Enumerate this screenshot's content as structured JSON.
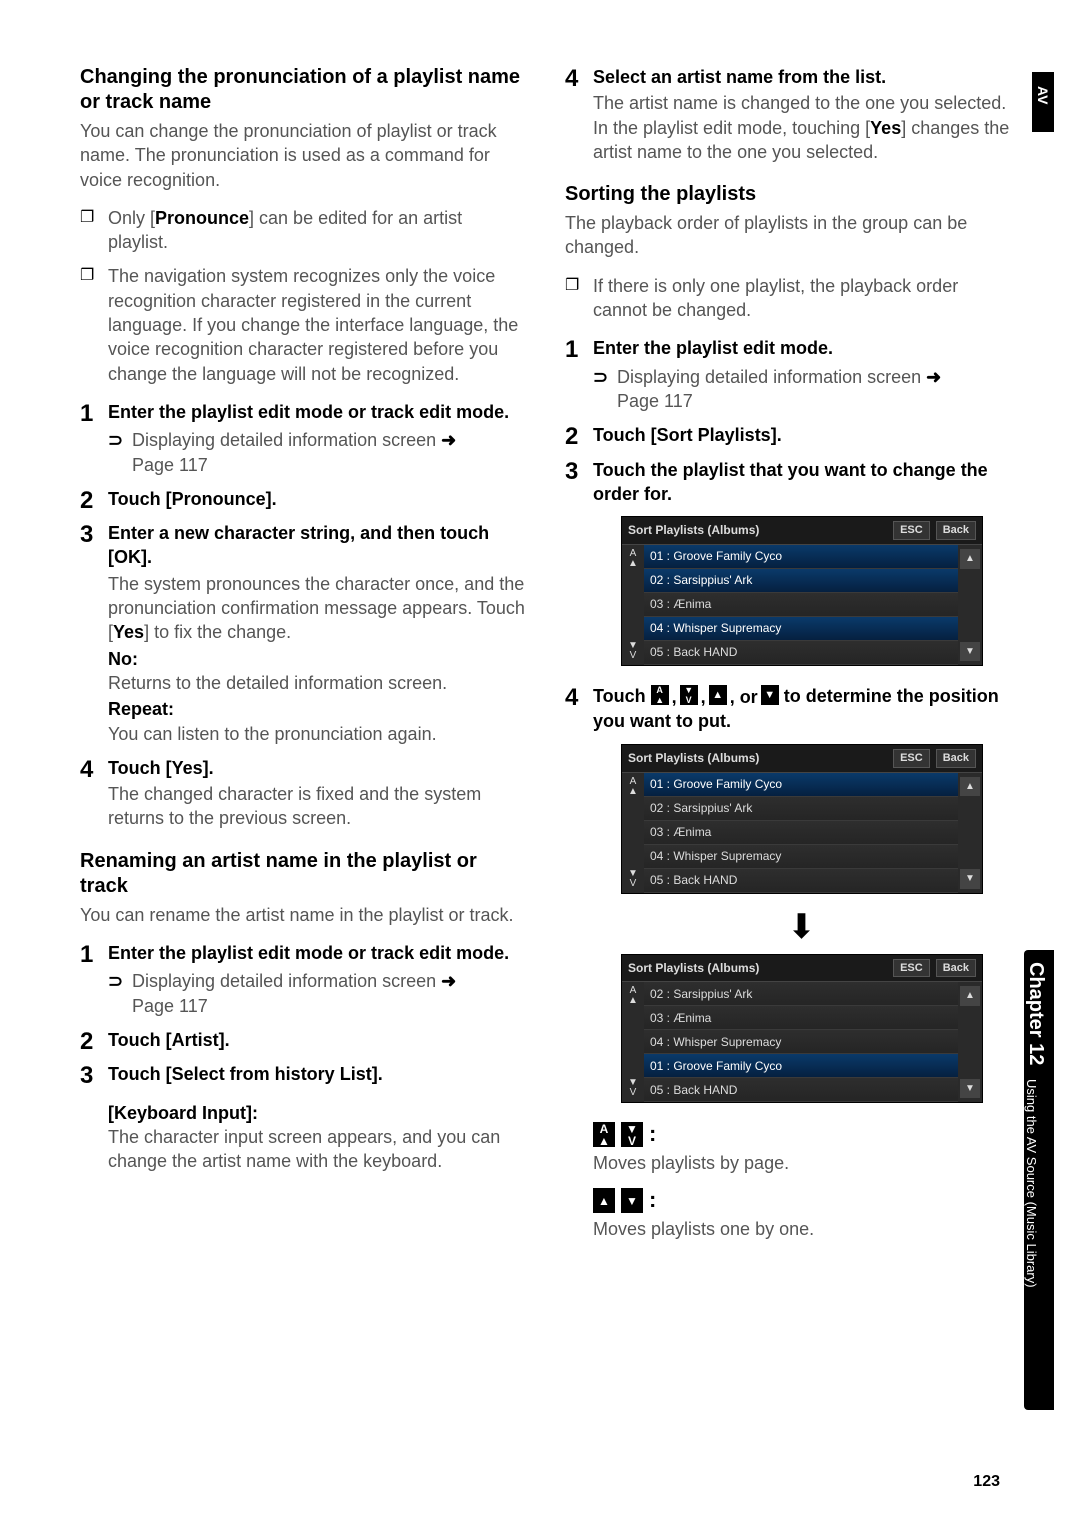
{
  "side": {
    "av": "AV",
    "chapter": "Chapter 12",
    "chapter_sub": "Using the AV Source (Music Library)"
  },
  "page_number": "123",
  "left": {
    "h1": "Changing the pronunciation of a playlist name or track name",
    "p1": "You can change the pronunciation of playlist or track name. The pronunciation is used as a command for voice recognition.",
    "notes": [
      "Only [Pronounce] can be edited for an artist playlist.",
      "The navigation system recognizes only the voice recognition character registered in the current language. If you change the interface language, the voice recognition character registered before you change the language will not be recognized."
    ],
    "note_bold_1": "Pronounce",
    "steps1": [
      {
        "head": "Enter the playlist edit mode or track edit mode.",
        "sub_pre": "Displaying detailed information screen",
        "sub_post": "Page 117"
      },
      {
        "head": "Touch [Pronounce]."
      },
      {
        "head": "Enter a new character string, and then touch [OK].",
        "body": "The system pronounces the character once, and the pronunciation confirmation message appears. Touch [Yes] to fix the change.",
        "no_label": "No:",
        "no_body": "Returns to the detailed information screen.",
        "rep_label": "Repeat:",
        "rep_body": "You can listen to the pronunciation again."
      },
      {
        "head": "Touch [Yes].",
        "body": "The changed character is fixed and the system returns to the previous screen."
      }
    ],
    "yes_inline": "Yes",
    "h2": "Renaming an artist name in the playlist or track",
    "p2": "You can rename the artist name in the playlist or track.",
    "steps2": [
      {
        "head": "Enter the playlist edit mode or track edit mode.",
        "sub_pre": "Displaying detailed information screen",
        "sub_post": "Page 117"
      },
      {
        "head": "Touch [Artist]."
      },
      {
        "head": "Touch [Select from history List].",
        "kb_label": "[Keyboard Input]:",
        "kb_body": "The character input screen appears, and you can change the artist name with the keyboard."
      }
    ]
  },
  "right": {
    "step4_head": "Select an artist name from the list.",
    "step4_body_pre": "The artist name is changed to the one you selected. In the playlist edit mode, touching [",
    "step4_yes": "Yes",
    "step4_body_post": "] changes the artist name to the one you selected.",
    "h_sort": "Sorting the playlists",
    "p_sort": "The playback order of playlists in the group can be changed.",
    "note_sort": "If there is only one playlist, the playback order cannot be changed.",
    "steps_sort": [
      {
        "head": "Enter the playlist edit mode.",
        "sub_pre": "Displaying detailed information screen",
        "sub_post": "Page 117"
      },
      {
        "head": "Touch [Sort Playlists]."
      },
      {
        "head": "Touch the playlist that you want to change the order for."
      }
    ],
    "step4b_pre": "Touch ",
    "step4b_post": " to determine the position you want to put.",
    "step4b_sep": ", or ",
    "screenshot": {
      "title": "Sort Playlists (Albums)",
      "esc": "ESC",
      "back": "Back",
      "rowsA": [
        {
          "t": "01 : Groove Family Cyco",
          "sel": true
        },
        {
          "t": "02 : Sarsippius' Ark",
          "sel": true
        },
        {
          "t": "03 : Ænima",
          "sel": false
        },
        {
          "t": "04 : Whisper Supremacy",
          "sel": true
        },
        {
          "t": "05 : Back HAND",
          "sel": false
        }
      ],
      "rowsB": [
        {
          "t": "01 : Groove Family Cyco",
          "sel": true
        },
        {
          "t": "02 : Sarsippius' Ark",
          "sel": false
        },
        {
          "t": "03 : Ænima",
          "sel": false
        },
        {
          "t": "04 : Whisper Supremacy",
          "sel": false
        },
        {
          "t": "05 : Back HAND",
          "sel": false
        }
      ],
      "rowsC": [
        {
          "t": "02 : Sarsippius' Ark",
          "sel": false
        },
        {
          "t": "03 : Ænima",
          "sel": false
        },
        {
          "t": "04 : Whisper Supremacy",
          "sel": false
        },
        {
          "t": "01 : Groove Family Cyco",
          "sel": true
        },
        {
          "t": "05 : Back HAND",
          "sel": false
        }
      ]
    },
    "moves_page": "Moves playlists by page.",
    "moves_one": "Moves playlists one by one."
  }
}
